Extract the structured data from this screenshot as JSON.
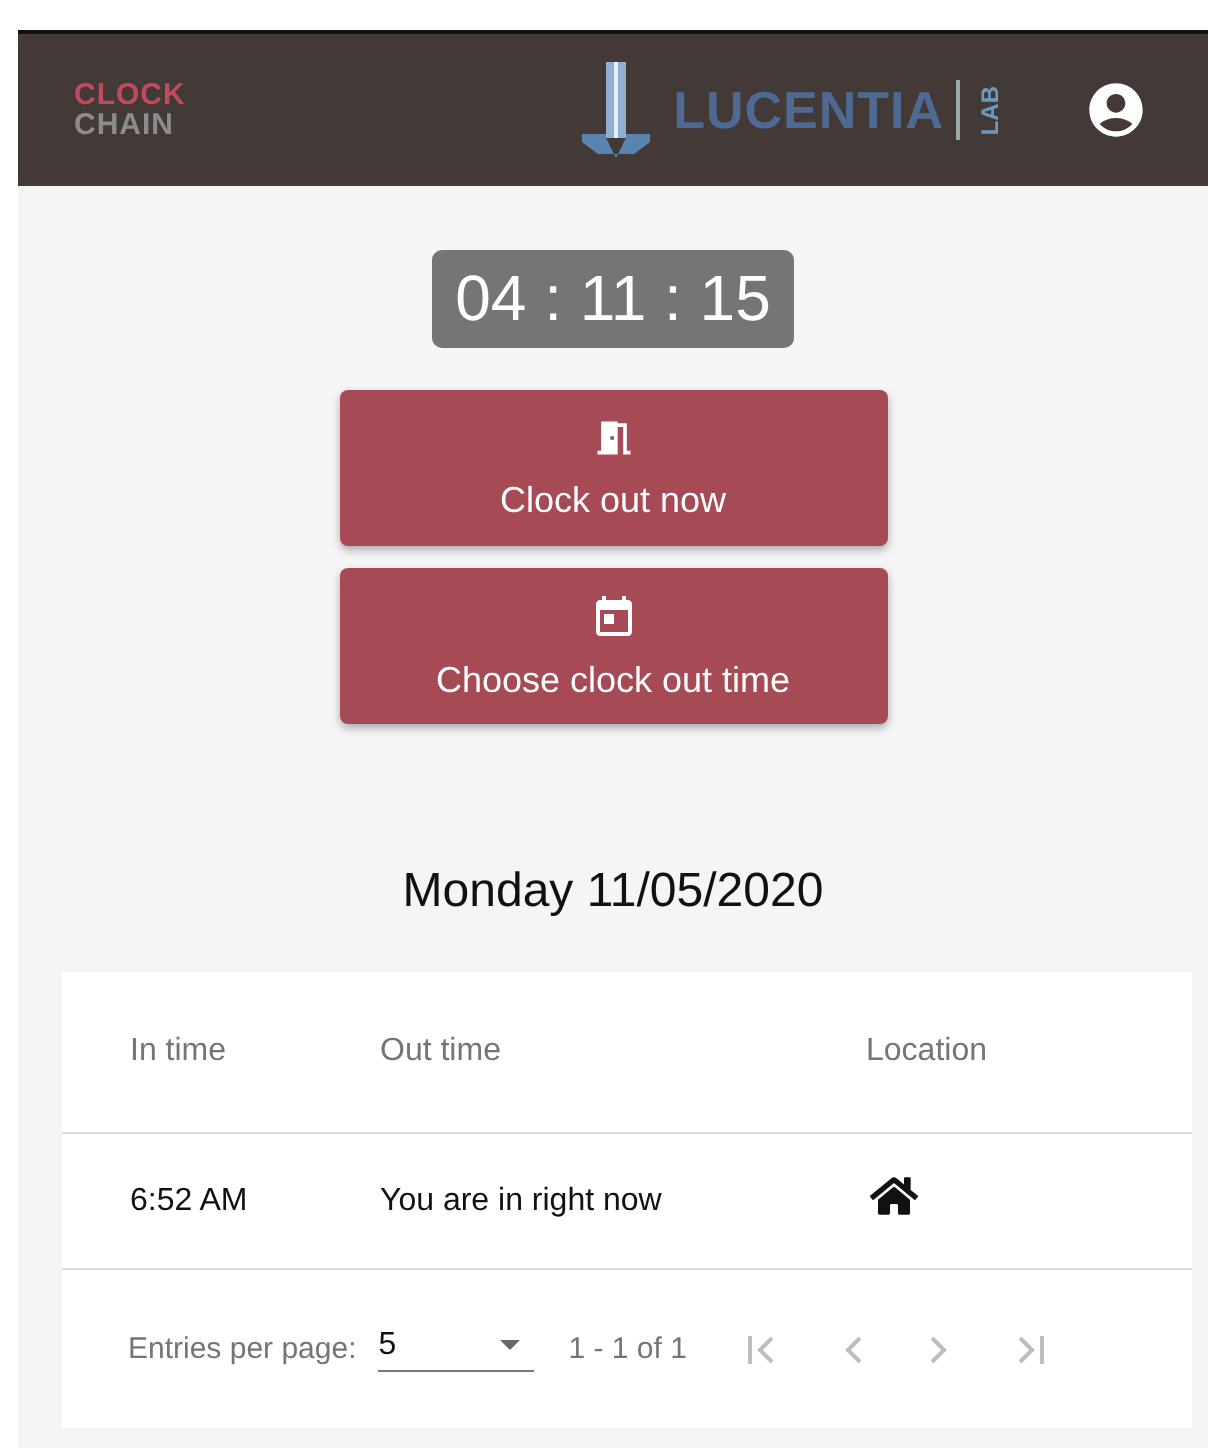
{
  "header": {
    "logo": {
      "top": "CLOCK",
      "bottom": "CHAIN"
    },
    "partner": {
      "name": "LUCENTIA",
      "tag": "LAB"
    }
  },
  "timer": "04 : 11 : 15",
  "actions": [
    {
      "kind": "door",
      "label": "Clock out now"
    },
    {
      "kind": "calendar",
      "label": "Choose clock out time"
    }
  ],
  "date": "Monday 11/05/2020",
  "table": {
    "columns": [
      "In time",
      "Out time",
      "Location"
    ],
    "rows": [
      {
        "in": "6:52 AM",
        "out": "You are in right now"
      }
    ]
  },
  "pagination": {
    "label": "Entries per page:",
    "per_page": "5",
    "range": "1 - 1 of 1",
    "buttons": [
      {
        "kind": "first",
        "disabled": true
      },
      {
        "kind": "prev",
        "disabled": true
      },
      {
        "kind": "next",
        "disabled": true
      },
      {
        "kind": "last",
        "disabled": true
      }
    ]
  }
}
